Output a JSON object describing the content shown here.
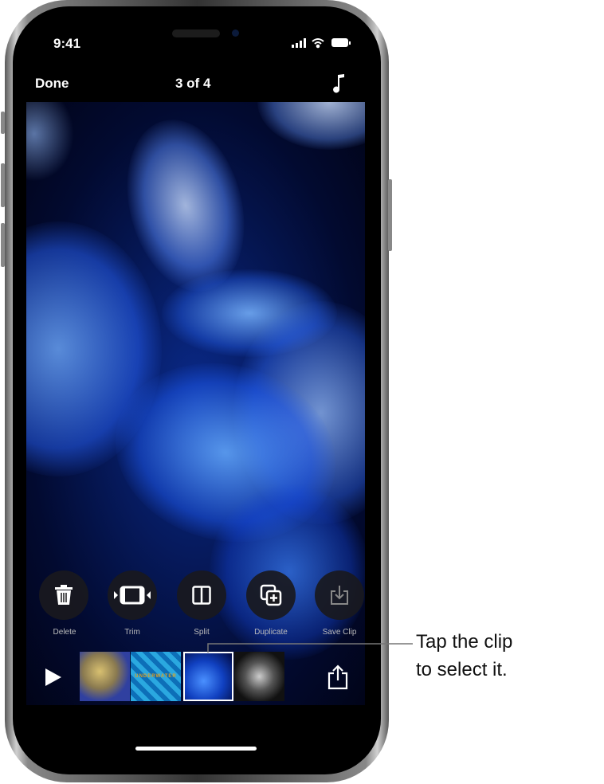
{
  "status_bar": {
    "time": "9:41",
    "icons": [
      "cellular-signal-icon",
      "wifi-icon",
      "battery-icon"
    ]
  },
  "nav": {
    "done_label": "Done",
    "title": "3 of 4",
    "music_icon": "music-note-icon"
  },
  "actions": [
    {
      "label": "Delete",
      "icon": "trash-icon"
    },
    {
      "label": "Trim",
      "icon": "trim-icon"
    },
    {
      "label": "Split",
      "icon": "split-icon"
    },
    {
      "label": "Duplicate",
      "icon": "duplicate-icon"
    },
    {
      "label": "Save Clip",
      "icon": "save-clip-icon"
    }
  ],
  "timeline": {
    "clips": [
      {
        "selected": false
      },
      {
        "text": "UNDERWATER",
        "selected": false
      },
      {
        "selected": true
      },
      {
        "selected": false
      }
    ],
    "play_icon": "play-icon",
    "share_icon": "share-icon"
  },
  "callout": {
    "line1": "Tap the clip",
    "line2": "to select it."
  }
}
